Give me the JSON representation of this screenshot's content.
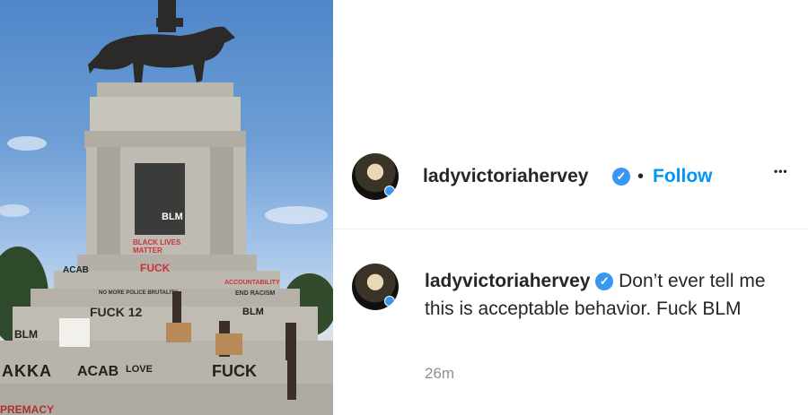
{
  "post": {
    "username": "ladyvictoriahervey",
    "follow_label": "Follow",
    "separator": "•",
    "more_label": "•••"
  },
  "comment": {
    "username": "ladyvictoriahervey",
    "text": "Don’t ever tell me this is acceptable behavior. Fuck BLM",
    "timestamp": "26m"
  },
  "photo": {
    "graffiti": [
      "BLM",
      "FUCK",
      "BLM",
      "ACAB",
      "AKKA",
      "ACAB",
      "LOVE",
      "FUCK",
      "BLM",
      "FUCK 12",
      "PREMACY",
      "BLACK LIVES MATTER",
      "ACCOUNTABILITY",
      "NO MORE POLICE BRUTALITY",
      "END RACISM"
    ]
  },
  "colors": {
    "link": "#0095f6",
    "verified": "#3897f0",
    "text": "#262626",
    "muted": "#8e8e8e"
  }
}
